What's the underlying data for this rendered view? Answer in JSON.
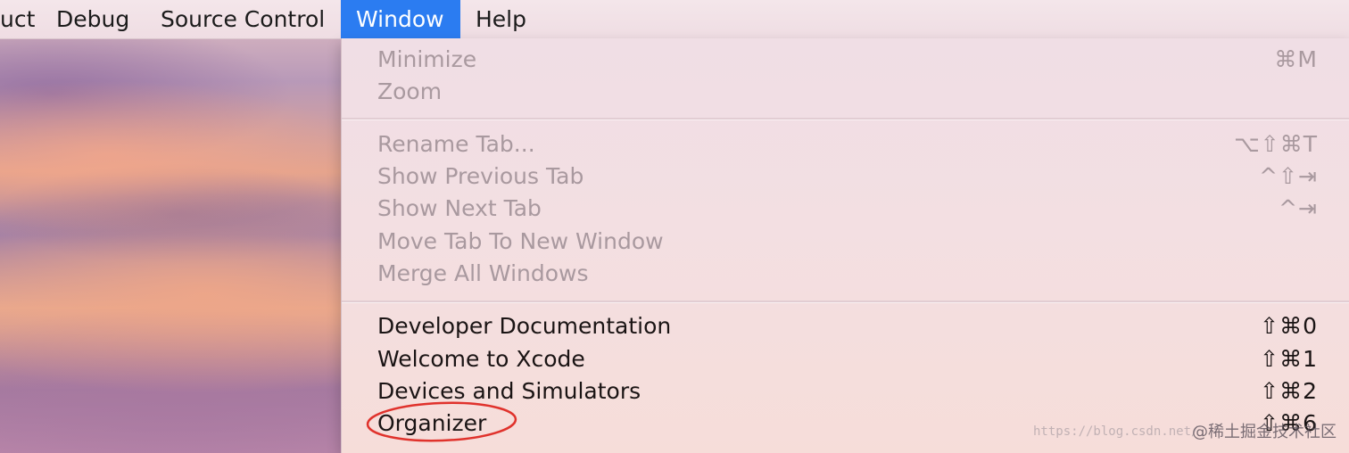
{
  "menubar": {
    "items": [
      {
        "label": "uct"
      },
      {
        "label": "Debug"
      },
      {
        "label": "Source Control"
      },
      {
        "label": "Window"
      },
      {
        "label": "Help"
      }
    ],
    "active_item": "Window",
    "active_color": "#2b7cf1"
  },
  "window_menu": {
    "groups": [
      {
        "items": [
          {
            "label": "Minimize",
            "shortcut": "⌘M",
            "enabled": false
          },
          {
            "label": "Zoom",
            "shortcut": "",
            "enabled": false
          }
        ]
      },
      {
        "items": [
          {
            "label": "Rename Tab...",
            "shortcut": "⌥⇧⌘T",
            "enabled": false
          },
          {
            "label": "Show Previous Tab",
            "shortcut": "^⇧⇥",
            "enabled": false
          },
          {
            "label": "Show Next Tab",
            "shortcut": "^⇥",
            "enabled": false
          },
          {
            "label": "Move Tab To New Window",
            "shortcut": "",
            "enabled": false
          },
          {
            "label": "Merge All Windows",
            "shortcut": "",
            "enabled": false
          }
        ]
      },
      {
        "items": [
          {
            "label": "Developer Documentation",
            "shortcut": "⇧⌘0",
            "enabled": true
          },
          {
            "label": "Welcome to Xcode",
            "shortcut": "⇧⌘1",
            "enabled": true
          },
          {
            "label": "Devices and Simulators",
            "shortcut": "⇧⌘2",
            "enabled": true
          },
          {
            "label": "Organizer",
            "shortcut": "⇧⌘6",
            "enabled": true
          }
        ]
      }
    ]
  },
  "annotation": {
    "circled_item": "Organizer",
    "color": "#e0322c"
  },
  "watermark": {
    "url": "https://blog.csdn.net/",
    "brand": "@稀土掘金技术社区"
  }
}
